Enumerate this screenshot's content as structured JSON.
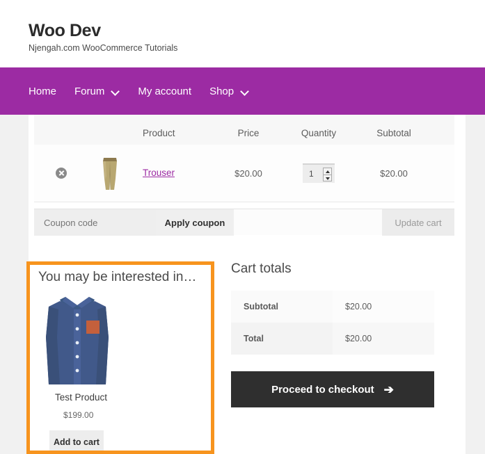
{
  "site": {
    "title": "Woo Dev",
    "tagline": "Njengah.com WooCommerce Tutorials"
  },
  "nav": {
    "items": [
      {
        "label": "Home",
        "has_caret": false
      },
      {
        "label": "Forum",
        "has_caret": true
      },
      {
        "label": "My account",
        "has_caret": false
      },
      {
        "label": "Shop",
        "has_caret": true
      }
    ]
  },
  "cart": {
    "headers": {
      "product": "Product",
      "price": "Price",
      "quantity": "Quantity",
      "subtotal": "Subtotal"
    },
    "rows": [
      {
        "remove_icon": "remove-circle-x-icon",
        "thumb_icon": "trouser-product-thumbnail",
        "name": "Trouser",
        "price": "$20.00",
        "quantity": "1",
        "subtotal": "$20.00"
      }
    ],
    "coupon": {
      "placeholder": "Coupon code",
      "value": "",
      "apply_label": "Apply coupon",
      "update_label": "Update cart"
    }
  },
  "cross_sells": {
    "heading": "You may be interested in…",
    "highlight_color": "#f7941e",
    "product": {
      "image_icon": "blue-dress-shirt-product-image",
      "name": "Test Product",
      "price": "$199.00",
      "add_to_cart_label": "Add to cart"
    }
  },
  "cart_totals": {
    "heading": "Cart totals",
    "rows": [
      {
        "label": "Subtotal",
        "value": "$20.00"
      },
      {
        "label": "Total",
        "value": "$20.00"
      }
    ],
    "checkout_label": "Proceed to checkout",
    "checkout_arrow": "➔"
  },
  "theme": {
    "nav_purple": "#9c2ba3",
    "checkout_dark": "#2f2f2f",
    "link_purple": "#9c2ba3"
  }
}
